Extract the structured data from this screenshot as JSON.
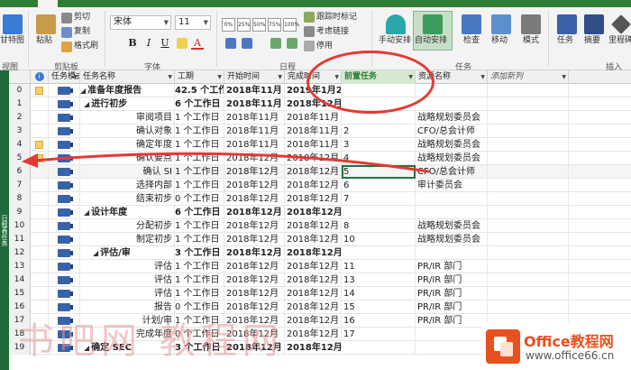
{
  "ribbon": {
    "view": {
      "gantt_label": "甘特图",
      "group": "视图"
    },
    "clipboard": {
      "paste": "粘贴",
      "cut": "剪切",
      "copy": "复制",
      "format_painter": "格式刷",
      "group": "剪贴板"
    },
    "font": {
      "family": "宋体",
      "size": "11",
      "bold": "B",
      "italic": "I",
      "underline": "U",
      "color_letter": "A",
      "group": "字体"
    },
    "schedule": {
      "pcts": [
        "0%",
        "25%",
        "50%",
        "75%",
        "100%"
      ],
      "mark_on_track": "跟踪时标记",
      "respect_links": "考虑链接",
      "inactivate": "停用",
      "group": "日程"
    },
    "tasks": {
      "manual": "手动安排",
      "auto": "自动安排",
      "inspect": "检查",
      "move": "移动",
      "mode": "模式",
      "group": "任务"
    },
    "insert": {
      "task": "任务",
      "summary": "摘要",
      "milestone": "里程碑",
      "group": "插入"
    }
  },
  "sheet": {
    "timeline_label": "日程表任务",
    "columns": {
      "mode": "任务模式",
      "name": "任务名称",
      "duration": "工期",
      "start": "开始时间",
      "finish": "完成时间",
      "predecessors": "前置任务",
      "resources": "资源名称",
      "add_new": "添加新列"
    },
    "rows": [
      {
        "id": "0",
        "note": true,
        "indent": 0,
        "summary": true,
        "name": "准备年度报告",
        "duration": "42.5 个工作日",
        "start": "2018年11月",
        "finish": "2019年1月2",
        "pred": "",
        "res": ""
      },
      {
        "id": "1",
        "note": false,
        "indent": 1,
        "summary": true,
        "name": "进行初步",
        "duration": "6 个工作日",
        "start": "2018年11月",
        "finish": "2018年12月",
        "pred": "",
        "res": ""
      },
      {
        "id": "2",
        "note": false,
        "indent": 2,
        "summary": false,
        "name": "审阅项目",
        "duration": "1 个工作日",
        "start": "2018年11月",
        "finish": "2018年11月",
        "pred": "",
        "res": "战略规划委员会"
      },
      {
        "id": "3",
        "note": false,
        "indent": 2,
        "summary": false,
        "name": "确认对象",
        "duration": "1 个工作日",
        "start": "2018年11月",
        "finish": "2018年11月",
        "pred": "2",
        "res": "CFO/总会计师"
      },
      {
        "id": "4",
        "note": true,
        "indent": 2,
        "summary": false,
        "name": "确定年度",
        "duration": "1 个工作日",
        "start": "2018年11月",
        "finish": "2018年11月",
        "pred": "3",
        "res": "战略规划委员会"
      },
      {
        "id": "5",
        "note": true,
        "indent": 2,
        "summary": false,
        "name": "确认要点",
        "duration": "1 个工作日",
        "start": "2018年12月",
        "finish": "2018年12月",
        "pred": "4",
        "res": "战略规划委员会"
      },
      {
        "id": "6",
        "note": false,
        "indent": 2,
        "summary": false,
        "name": "确认 SI",
        "duration": "1 个工作日",
        "start": "2018年12月",
        "finish": "2018年12月",
        "pred": "5",
        "res": "CFO/总会计师",
        "selected": true
      },
      {
        "id": "7",
        "note": false,
        "indent": 2,
        "summary": false,
        "name": "选择内部",
        "duration": "1 个工作日",
        "start": "2018年12月",
        "finish": "2018年12月",
        "pred": "6",
        "res": "审计委员会"
      },
      {
        "id": "8",
        "note": false,
        "indent": 2,
        "summary": false,
        "name": "结束初步",
        "duration": "0 个工作日",
        "start": "2018年12月",
        "finish": "2018年12月",
        "pred": "7",
        "res": ""
      },
      {
        "id": "9",
        "note": false,
        "indent": 1,
        "summary": true,
        "name": "设计年度",
        "duration": "6 个工作日",
        "start": "2018年12月",
        "finish": "2018年12月",
        "pred": "",
        "res": ""
      },
      {
        "id": "10",
        "note": false,
        "indent": 2,
        "summary": false,
        "name": "分配初步",
        "duration": "1 个工作日",
        "start": "2018年12月",
        "finish": "2018年12月",
        "pred": "8",
        "res": "战略规划委员会"
      },
      {
        "id": "11",
        "note": false,
        "indent": 2,
        "summary": false,
        "name": "制定初步",
        "duration": "1 个工作日",
        "start": "2018年12月",
        "finish": "2018年12月",
        "pred": "10",
        "res": "战略规划委员会"
      },
      {
        "id": "12",
        "note": false,
        "indent": 2,
        "summary": true,
        "name": "评估/审",
        "duration": "3 个工作日",
        "start": "2018年12月",
        "finish": "2018年12月",
        "pred": "",
        "res": ""
      },
      {
        "id": "13",
        "note": false,
        "indent": 3,
        "summary": false,
        "name": "评估",
        "duration": "1 个工作日",
        "start": "2018年12月",
        "finish": "2018年12月",
        "pred": "11",
        "res": "PR/IR 部门"
      },
      {
        "id": "14",
        "note": false,
        "indent": 3,
        "summary": false,
        "name": "评估",
        "duration": "1 个工作日",
        "start": "2018年12月",
        "finish": "2018年12月",
        "pred": "13",
        "res": "PR/IR 部门"
      },
      {
        "id": "15",
        "note": false,
        "indent": 3,
        "summary": false,
        "name": "评估",
        "duration": "1 个工作日",
        "start": "2018年12月",
        "finish": "2018年12月",
        "pred": "14",
        "res": "PR/IR 部门"
      },
      {
        "id": "16",
        "note": false,
        "indent": 3,
        "summary": false,
        "name": "报告",
        "duration": "0 个工作日",
        "start": "2018年12月",
        "finish": "2018年12月",
        "pred": "15",
        "res": "PR/IR 部门"
      },
      {
        "id": "17",
        "note": false,
        "indent": 2,
        "summary": false,
        "name": "计划/审",
        "duration": "1 个工作日",
        "start": "2018年12月",
        "finish": "2018年12月",
        "pred": "16",
        "res": "PR/IR 部门"
      },
      {
        "id": "18",
        "note": false,
        "indent": 2,
        "summary": false,
        "name": "完成年度",
        "duration": "0 个工作日",
        "start": "2018年12月",
        "finish": "2018年12月",
        "pred": "17",
        "res": ""
      },
      {
        "id": "19",
        "note": false,
        "indent": 1,
        "summary": true,
        "name": "确定 SEC",
        "duration": "3 个工作日",
        "start": "2018年12月",
        "finish": "2018年12月",
        "pred": "",
        "res": ""
      }
    ]
  },
  "overlay": {
    "watermark_text": "书吧网 教程网",
    "logo_title": "Office教程网",
    "logo_sub": "www.office66.cn",
    "annotation_color": "#e53935",
    "logo_color": "#e8501f"
  }
}
